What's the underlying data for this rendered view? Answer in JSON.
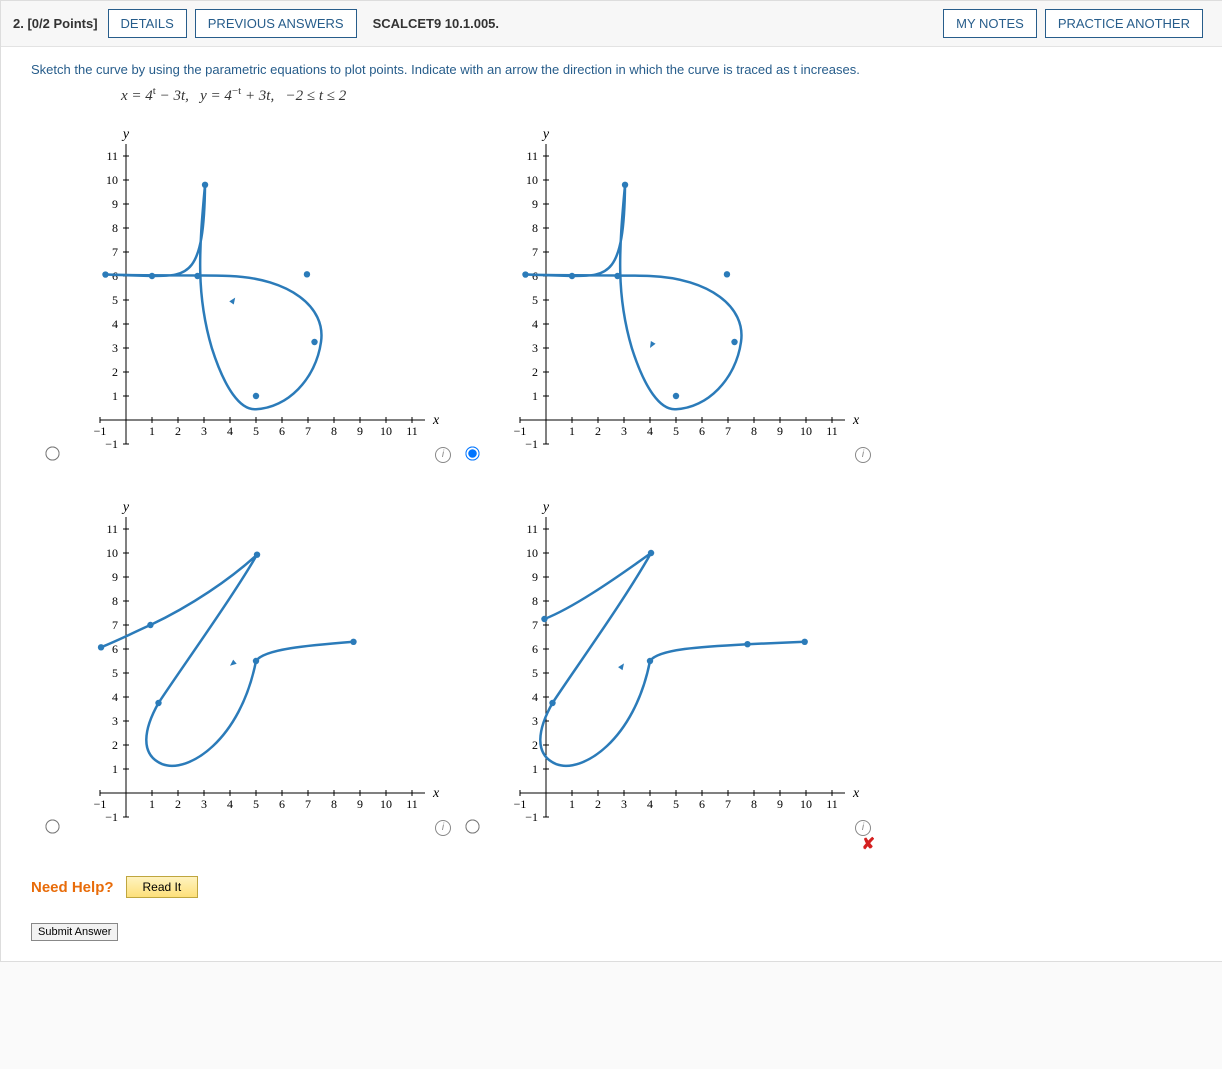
{
  "header": {
    "question_number": "2.",
    "points": "[0/2 Points]",
    "details": "DETAILS",
    "previous_answers": "PREVIOUS ANSWERS",
    "source": "SCALCET9 10.1.005.",
    "my_notes": "MY NOTES",
    "practice_another": "PRACTICE ANOTHER"
  },
  "prompt_text": "Sketch the curve by using the parametric equations to plot points. Indicate with an arrow the direction in which the curve is traced as t increases.",
  "equations_html": "x = 4<sup>t</sup> − 3t,&nbsp;&nbsp;&nbsp;y = 4<sup>−t</sup> + 3t,&nbsp;&nbsp;&nbsp;−2 ≤ t ≤ 2",
  "need_help_label": "Need Help?",
  "read_it": "Read It",
  "submit_answer": "Submit Answer",
  "selected_option": 1,
  "incorrect_option": 3,
  "chart_data": [
    {
      "type": "line",
      "name": "option-A-top-left",
      "xlabel": "x",
      "ylabel": "y",
      "xlim": [
        -1,
        11.5
      ],
      "ylim": [
        -1,
        11.5
      ],
      "xticks": [
        -1,
        1,
        2,
        3,
        4,
        5,
        6,
        7,
        8,
        9,
        10,
        11
      ],
      "yticks": [
        -1,
        1,
        2,
        3,
        4,
        5,
        6,
        7,
        8,
        9,
        10,
        11
      ],
      "arrow_direction": "up-right along upper branch",
      "points": [
        {
          "x": 3.04,
          "y": 9.8
        },
        {
          "x": 2.75,
          "y": 6.0
        },
        {
          "x": 5.0,
          "y": 1.0
        },
        {
          "x": 7.25,
          "y": 3.25
        },
        {
          "x": 6.96,
          "y": 6.07
        },
        {
          "x": 1.0,
          "y": 6.0
        },
        {
          "x": -0.79,
          "y": 6.06
        }
      ]
    },
    {
      "type": "line",
      "name": "option-B-top-right-selected",
      "xlabel": "x",
      "ylabel": "y",
      "xlim": [
        -1,
        11.5
      ],
      "ylim": [
        -1,
        11.5
      ],
      "xticks": [
        -1,
        1,
        2,
        3,
        4,
        5,
        6,
        7,
        8,
        9,
        10,
        11
      ],
      "yticks": [
        -1,
        1,
        2,
        3,
        4,
        5,
        6,
        7,
        8,
        9,
        10,
        11
      ],
      "selected": true,
      "arrow_direction": "down into loop then up-right",
      "points": [
        {
          "x": 3.04,
          "y": 9.8
        },
        {
          "x": 2.75,
          "y": 6.0
        },
        {
          "x": 5.0,
          "y": 1.0
        },
        {
          "x": 7.25,
          "y": 3.25
        },
        {
          "x": 6.96,
          "y": 6.07
        },
        {
          "x": 1.0,
          "y": 6.0
        },
        {
          "x": -0.79,
          "y": 6.06
        }
      ]
    },
    {
      "type": "line",
      "name": "option-C-bottom-left",
      "xlabel": "x",
      "ylabel": "y",
      "xlim": [
        -1,
        11.5
      ],
      "ylim": [
        -1,
        11.5
      ],
      "xticks": [
        -1,
        1,
        2,
        3,
        4,
        5,
        6,
        7,
        8,
        9,
        10,
        11
      ],
      "yticks": [
        -1,
        1,
        2,
        3,
        4,
        5,
        6,
        7,
        8,
        9,
        10,
        11
      ],
      "arrow_direction": "down-left along upper branch",
      "points": [
        {
          "x": 5.04,
          "y": 9.93
        },
        {
          "x": 1.25,
          "y": 3.75
        },
        {
          "x": 5.0,
          "y": 5.5
        },
        {
          "x": 8.75,
          "y": 6.3
        },
        {
          "x": 0.94,
          "y": 7.0
        },
        {
          "x": -0.96,
          "y": 6.07
        }
      ]
    },
    {
      "type": "line",
      "name": "option-D-bottom-right-incorrect",
      "xlabel": "x",
      "ylabel": "y",
      "xlim": [
        -1,
        11.5
      ],
      "ylim": [
        -1,
        11.5
      ],
      "xticks": [
        -1,
        1,
        2,
        3,
        4,
        5,
        6,
        7,
        8,
        9,
        10,
        11
      ],
      "yticks": [
        -1,
        1,
        2,
        3,
        4,
        5,
        6,
        7,
        8,
        9,
        10,
        11
      ],
      "previously_answered_incorrect": true,
      "arrow_direction": "up-right along upper branch from loop",
      "points": [
        {
          "x": 4.04,
          "y": 10.0
        },
        {
          "x": 0.25,
          "y": 3.75
        },
        {
          "x": 4.0,
          "y": 5.5
        },
        {
          "x": 7.75,
          "y": 6.2
        },
        {
          "x": -0.06,
          "y": 7.25
        },
        {
          "x": 9.95,
          "y": 6.3
        }
      ]
    }
  ]
}
